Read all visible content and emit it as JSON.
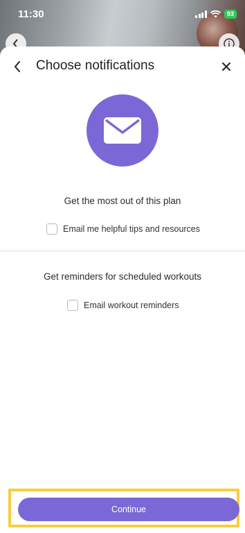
{
  "status_bar": {
    "time": "11:30",
    "battery": "93"
  },
  "header": {
    "title": "Choose notifications"
  },
  "section_one": {
    "heading": "Get the most out of this plan",
    "checkbox_label": "Email me helpful tips and resources",
    "checked": false
  },
  "section_two": {
    "heading": "Get reminders for scheduled workouts",
    "checkbox_label": "Email workout reminders",
    "checked": false
  },
  "footer": {
    "continue_label": "Continue"
  },
  "colors": {
    "accent": "#7b68d6",
    "highlight": "#f5cf3b",
    "battery": "#34c759"
  },
  "icons": [
    "back-chevron-icon",
    "close-icon",
    "envelope-icon",
    "info-icon",
    "signal-icon",
    "wifi-icon"
  ]
}
